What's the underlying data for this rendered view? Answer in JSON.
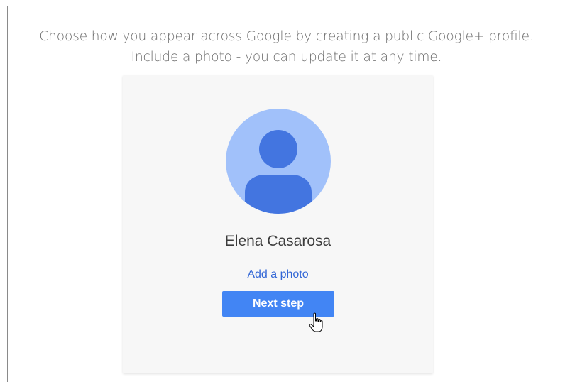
{
  "intro": {
    "line1": "Choose how you appear across Google by creating a public Google+ profile.",
    "line2": "Include a photo - you can update it at any time."
  },
  "profile": {
    "name": "Elena Casarosa",
    "avatar_icon": "person-icon",
    "avatar_bg": "#a1c1fa",
    "avatar_fg": "#4375e0"
  },
  "actions": {
    "add_photo_label": "Add a photo",
    "next_step_label": "Next step"
  },
  "colors": {
    "primary_button": "#4285f4",
    "link": "#3367d6"
  },
  "cursor_icon": "hand-pointer-icon"
}
